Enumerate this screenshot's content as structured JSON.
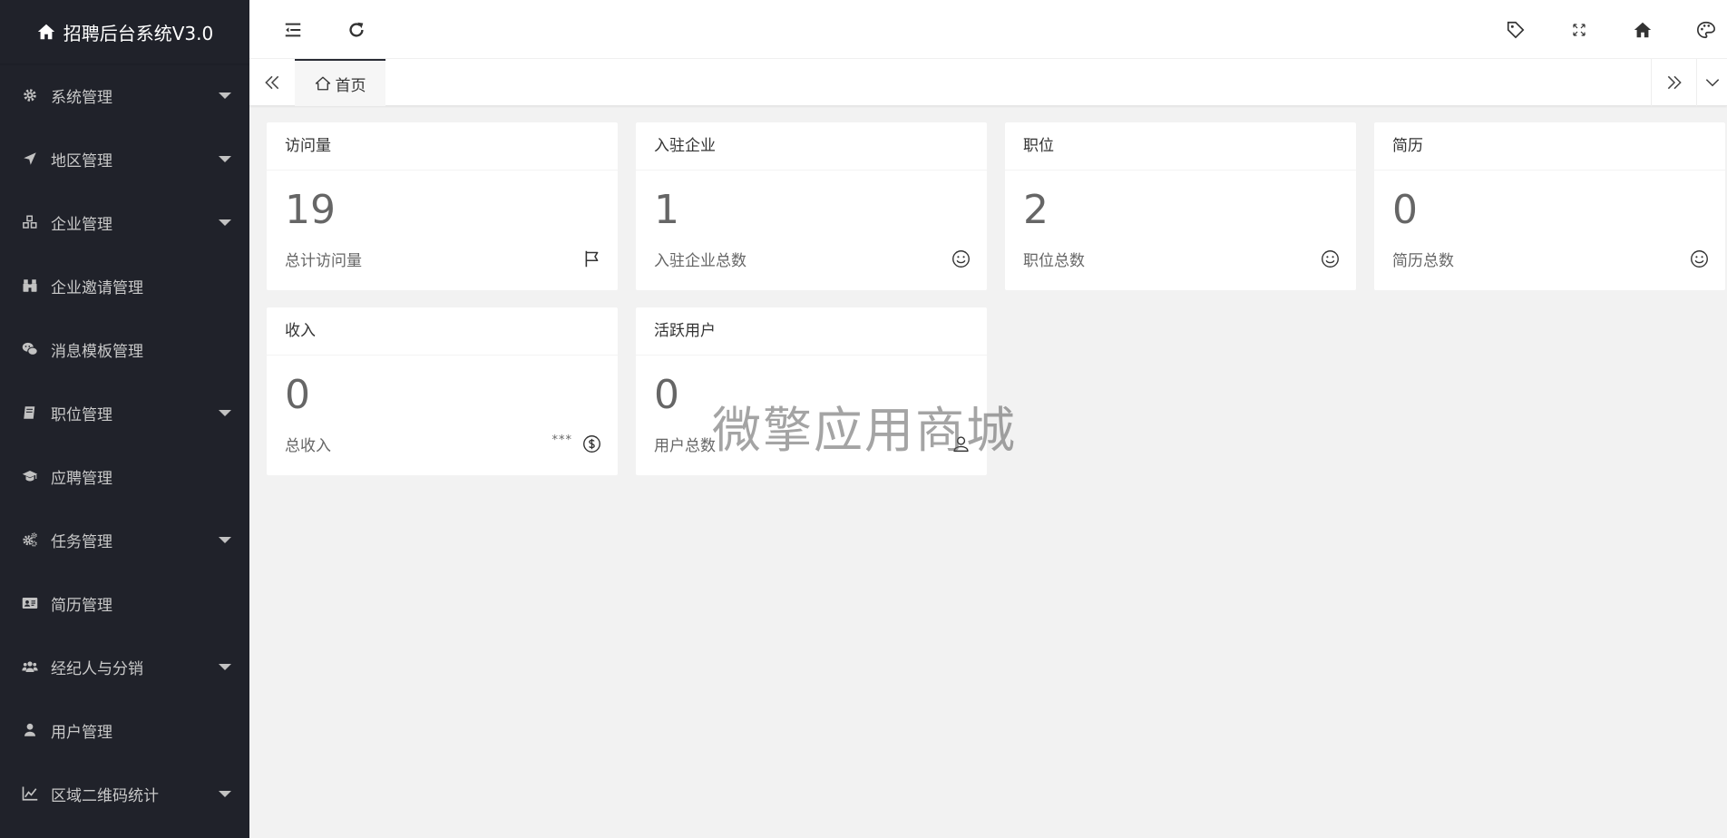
{
  "app": {
    "title": "招聘后台系统V3.0"
  },
  "sidebar": {
    "items": [
      {
        "label": "系统管理",
        "icon": "gear-icon",
        "has_submenu": true
      },
      {
        "label": "地区管理",
        "icon": "location-arrow-icon",
        "has_submenu": true
      },
      {
        "label": "企业管理",
        "icon": "cubes-icon",
        "has_submenu": true
      },
      {
        "label": "企业邀请管理",
        "icon": "binoculars-icon",
        "has_submenu": false
      },
      {
        "label": "消息模板管理",
        "icon": "wechat-icon",
        "has_submenu": false
      },
      {
        "label": "职位管理",
        "icon": "book-icon",
        "has_submenu": true
      },
      {
        "label": "应聘管理",
        "icon": "graduation-cap-icon",
        "has_submenu": false
      },
      {
        "label": "任务管理",
        "icon": "gears-icon",
        "has_submenu": true
      },
      {
        "label": "简历管理",
        "icon": "id-card-icon",
        "has_submenu": false
      },
      {
        "label": "经纪人与分销",
        "icon": "users-icon",
        "has_submenu": true
      },
      {
        "label": "用户管理",
        "icon": "user-icon",
        "has_submenu": false
      },
      {
        "label": "区域二维码统计",
        "icon": "line-chart-icon",
        "has_submenu": true
      }
    ]
  },
  "header": {
    "left_icons": [
      "menu-collapse-icon",
      "refresh-icon"
    ],
    "right_icons": [
      "tag-icon",
      "fullscreen-icon",
      "home-icon",
      "palette-icon"
    ]
  },
  "tabs": {
    "items": [
      {
        "label": "首页",
        "icon": "home-outline-icon",
        "active": true
      }
    ]
  },
  "cards": [
    {
      "title": "访问量",
      "value": "19",
      "subtitle": "总计访问量",
      "icon": "flag-icon",
      "extra": ""
    },
    {
      "title": "入驻企业",
      "value": "1",
      "subtitle": "入驻企业总数",
      "icon": "smile-icon",
      "extra": ""
    },
    {
      "title": "职位",
      "value": "2",
      "subtitle": "职位总数",
      "icon": "smile-icon",
      "extra": ""
    },
    {
      "title": "简历",
      "value": "0",
      "subtitle": "简历总数",
      "icon": "smile-icon",
      "extra": ""
    },
    {
      "title": "收入",
      "value": "0",
      "subtitle": "总收入",
      "icon": "dollar-icon",
      "extra": "***"
    },
    {
      "title": "活跃用户",
      "value": "0",
      "subtitle": "用户总数",
      "icon": "user-outline-icon",
      "extra": ""
    }
  ],
  "watermark": "微擎应用商城",
  "colors": {
    "sidebar_bg": "#20222a",
    "header_bg": "#ffffff",
    "content_bg": "#f2f2f2",
    "card_bg": "#ffffff",
    "tab_active_border": "#292b34"
  }
}
